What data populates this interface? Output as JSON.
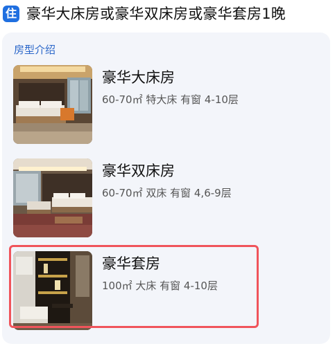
{
  "header": {
    "badge": "住",
    "title": "豪华大床房或豪华双床房或豪华套房1晚"
  },
  "section": {
    "title": "房型介绍"
  },
  "rooms": [
    {
      "name": "豪华大床房",
      "details": "60-70㎡  特大床  有窗  4-10层",
      "selected": false
    },
    {
      "name": "豪华双床房",
      "details": "60-70㎡  双床  有窗  4,6-9层",
      "selected": false
    },
    {
      "name": "豪华套房",
      "details": "100㎡  大床  有窗  4-10层",
      "selected": true
    }
  ],
  "colors": {
    "badge": "#1f6fe0",
    "section_title": "#2a66c9",
    "card_background": "#f3f5fa",
    "highlight_border": "#f0545b"
  }
}
